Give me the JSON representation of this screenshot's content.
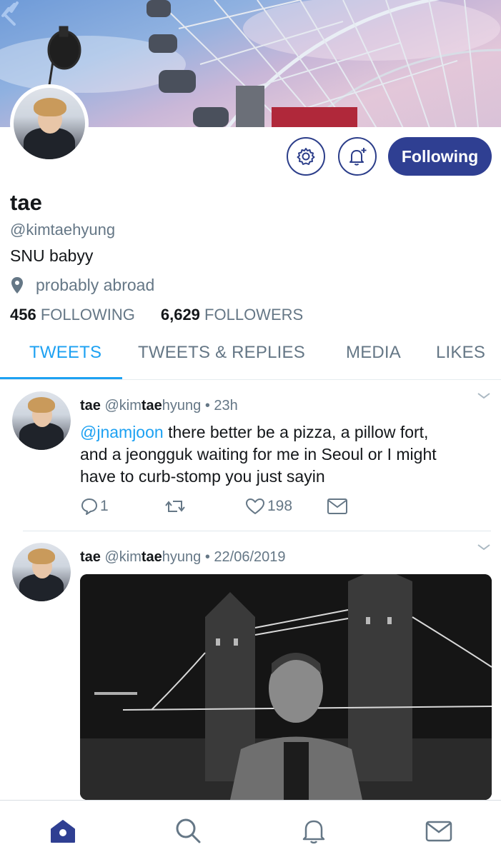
{
  "profile": {
    "name": "tae",
    "handle": "@kimtaehyung",
    "bio": "SNU babyy",
    "location": "probably abroad",
    "following_count": "456",
    "following_label": "FOLLOWING",
    "followers_count": "6,629",
    "followers_label": "FOLLOWERS"
  },
  "buttons": {
    "follow_label": "Following",
    "settings_icon": "gear-icon",
    "notify_icon": "bell-plus-icon"
  },
  "tabs": [
    {
      "label": "TWEETS",
      "active": true
    },
    {
      "label": "TWEETS & REPLIES",
      "active": false
    },
    {
      "label": "MEDIA",
      "active": false
    },
    {
      "label": "LIKES",
      "active": false
    }
  ],
  "tweets": [
    {
      "name": "tae",
      "handle_prefix": "@kim",
      "handle_bold": "tae",
      "handle_suffix": "hyung",
      "time": "23h",
      "mention": "@jnamjoon",
      "text_line1": " there better be a pizza, a pillow fort,",
      "text_line2": "and a jeongguk waiting for me in Seoul or I might",
      "text_line3": "have to curb-stomp you just sayin",
      "replies": "1",
      "likes": "198"
    },
    {
      "name": "tae",
      "handle_prefix": "@kim",
      "handle_bold": "tae",
      "handle_suffix": "hyung",
      "time": "22/06/2019"
    }
  ],
  "nav": [
    "home-icon",
    "search-icon",
    "notifications-icon",
    "messages-icon"
  ],
  "colors": {
    "accent": "#1da1f2",
    "button_navy": "#2f3f92",
    "muted": "#657786"
  }
}
